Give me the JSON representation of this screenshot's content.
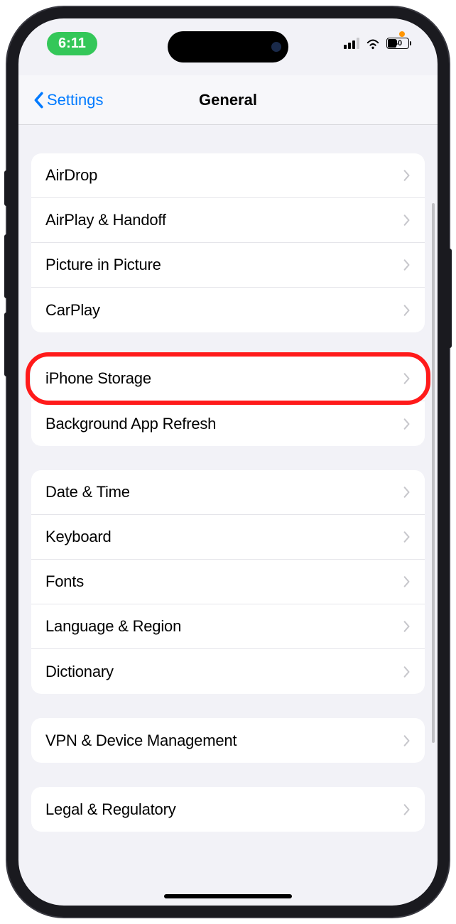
{
  "status": {
    "time": "6:11",
    "battery_percent": "40"
  },
  "nav": {
    "back_label": "Settings",
    "title": "General"
  },
  "sections": [
    {
      "rows": [
        {
          "label": "AirDrop",
          "name": "airdrop"
        },
        {
          "label": "AirPlay & Handoff",
          "name": "airplay-handoff"
        },
        {
          "label": "Picture in Picture",
          "name": "picture-in-picture"
        },
        {
          "label": "CarPlay",
          "name": "carplay"
        }
      ]
    },
    {
      "rows": [
        {
          "label": "iPhone Storage",
          "name": "iphone-storage",
          "highlighted": true
        },
        {
          "label": "Background App Refresh",
          "name": "background-app-refresh"
        }
      ]
    },
    {
      "rows": [
        {
          "label": "Date & Time",
          "name": "date-time"
        },
        {
          "label": "Keyboard",
          "name": "keyboard"
        },
        {
          "label": "Fonts",
          "name": "fonts"
        },
        {
          "label": "Language & Region",
          "name": "language-region"
        },
        {
          "label": "Dictionary",
          "name": "dictionary"
        }
      ]
    },
    {
      "rows": [
        {
          "label": "VPN & Device Management",
          "name": "vpn-device-management"
        }
      ]
    },
    {
      "rows": [
        {
          "label": "Legal & Regulatory",
          "name": "legal-regulatory"
        }
      ]
    }
  ],
  "highlight_color": "#ff1a1a"
}
